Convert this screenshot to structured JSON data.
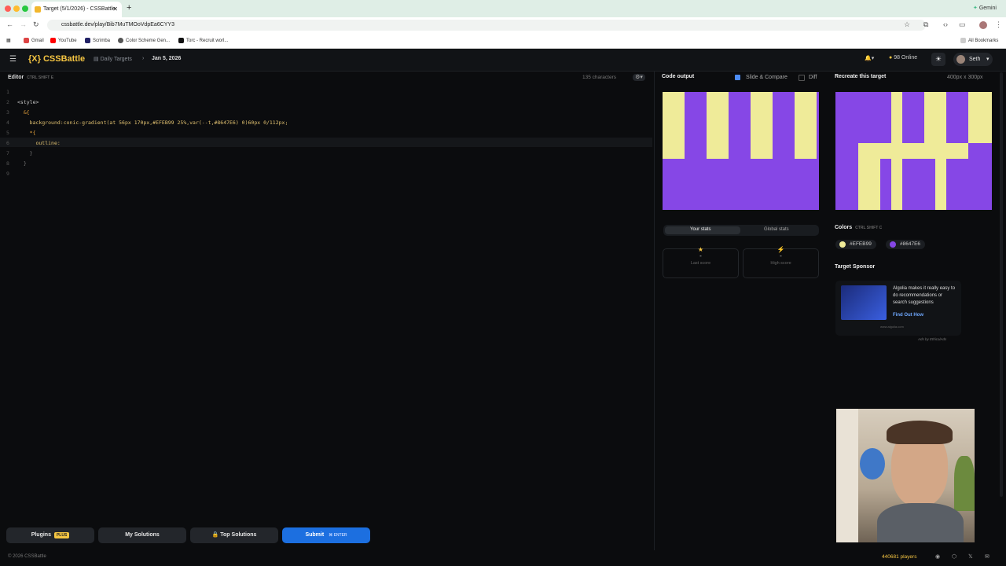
{
  "browser": {
    "tab_title": "Target (5/1/2026) - CSSBattle",
    "new_tab": "+",
    "gemini": "Gemini",
    "url": "cssbattle.dev/play/Bib7MuTMOoVdpEa6CYY3",
    "bookmarks": [
      "Gmail",
      "YouTube",
      "Scrimba",
      "Color Scheme Gen...",
      "Torc - Recruit worl..."
    ],
    "all_bookmarks": "All Bookmarks"
  },
  "app": {
    "logo": "{X} CSSBattle",
    "breadcrumb": "Daily Targets",
    "date": "Jan 5, 2026",
    "online": "98 Online",
    "user": "Seth"
  },
  "editor": {
    "label": "Editor",
    "shortcut": "CTRL  SHIFT  E",
    "char_count": "135 characters",
    "lines": [
      "",
      "<style>",
      "  &{",
      "    background:conic-gradient(at 56px 170px,#EFEB99 25%,var(--t,#8647E6) 0)60px 0/112px;",
      "    *{",
      "      outline:",
      "    }",
      "  }",
      ""
    ]
  },
  "buttons": {
    "plugins": "Plugins",
    "plus": "PLUS",
    "my_solutions": "My Solutions",
    "top_solutions": "Top Solutions",
    "submit": "Submit",
    "submit_shortcut": "⌘  ENTER"
  },
  "output": {
    "title": "Code output",
    "slide_compare": "Slide & Compare",
    "diff": "Diff"
  },
  "target": {
    "title": "Recreate this target",
    "size": "400px x 300px"
  },
  "stats": {
    "your_stats": "Your stats",
    "global_stats": "Global stats",
    "last_score_value": "-",
    "last_score_label": "Last score",
    "high_score_value": "-",
    "high_score_label": "High score"
  },
  "colors": {
    "label": "Colors",
    "shortcut": "CTRL  SHIFT  C",
    "yellow": "#EFEB99",
    "purple": "#8647E6"
  },
  "sponsor": {
    "title": "Target Sponsor",
    "text": "Algolia makes it really easy to do recommendations or search suggestions",
    "link": "Find Out How",
    "domain": "www.algolia.com",
    "ads_by": "Ads by EthicalAds"
  },
  "footer": {
    "copyright": "© 2026 CSSBattle",
    "players": "440681 players"
  }
}
